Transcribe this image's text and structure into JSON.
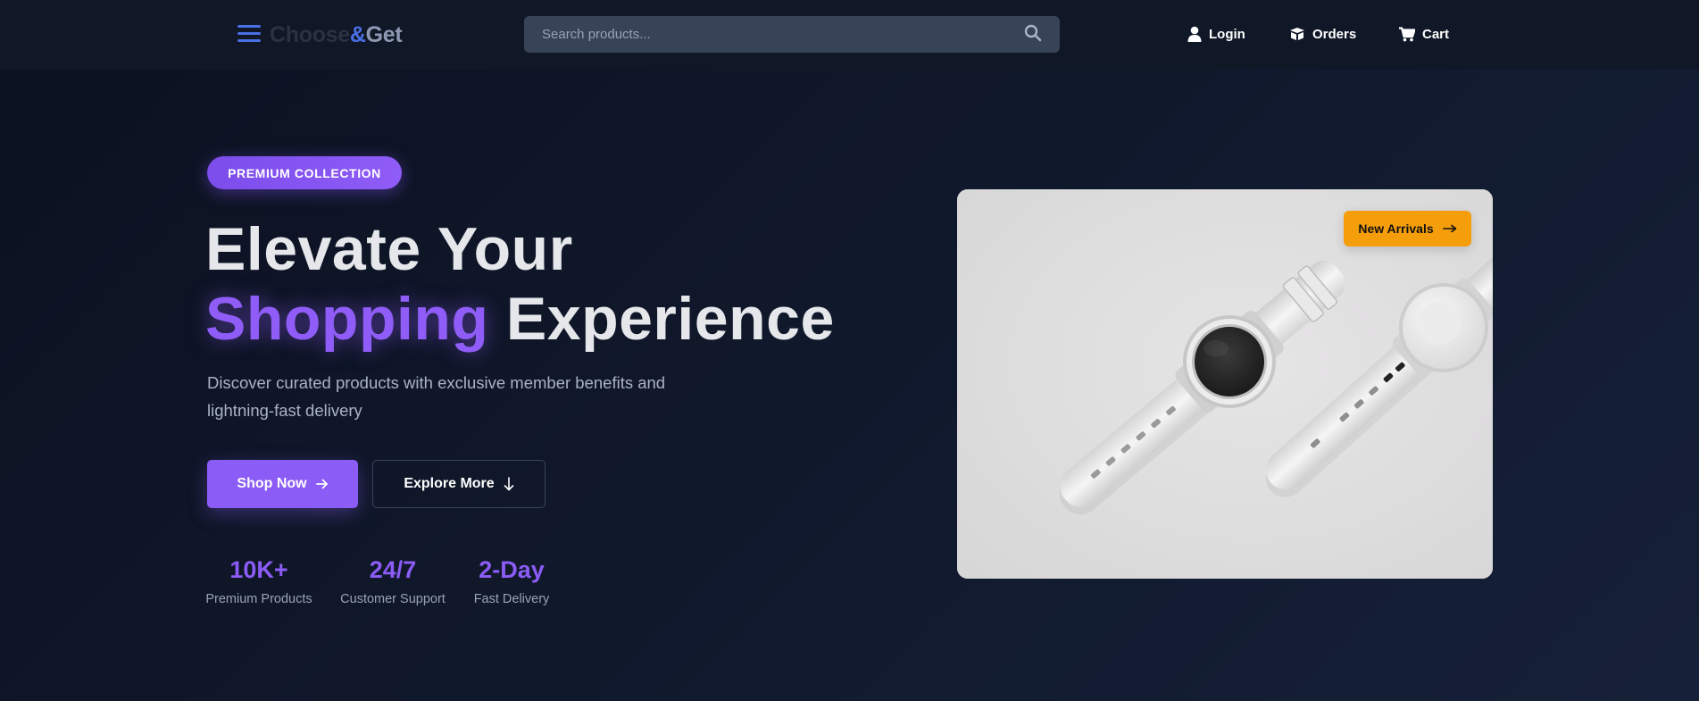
{
  "header": {
    "logo": {
      "part1": "Choose",
      "part2": "&",
      "part3": "Get"
    },
    "search": {
      "placeholder": "Search products..."
    },
    "nav": {
      "login": "Login",
      "orders": "Orders",
      "cart": "Cart"
    }
  },
  "hero": {
    "badge": "PREMIUM COLLECTION",
    "title": {
      "line1": "Elevate Your",
      "accent": "Shopping",
      "rest": "Experience"
    },
    "description": "Discover curated products with exclusive member benefits and lightning-fast delivery",
    "buttons": {
      "primary": "Shop Now",
      "secondary": "Explore More"
    },
    "stats": [
      {
        "value": "10K+",
        "label": "Premium Products"
      },
      {
        "value": "24/7",
        "label": "Customer Support"
      },
      {
        "value": "2-Day",
        "label": "Fast Delivery"
      }
    ]
  },
  "product": {
    "tag": "New Arrivals"
  },
  "icons": {
    "menu": "hamburger-menu-icon",
    "search": "search-icon",
    "login": "user-icon",
    "orders": "box-icon",
    "cart": "cart-icon",
    "shop_now": "arrow-right-icon",
    "explore": "arrow-down-icon",
    "arrivals": "long-arrow-right-icon"
  },
  "colors": {
    "background": "#0c1120",
    "header": "#101827",
    "accent_purple": "#8b5cf6",
    "logo_blue": "#4b6fe6",
    "tag_orange": "#f59e0b"
  }
}
